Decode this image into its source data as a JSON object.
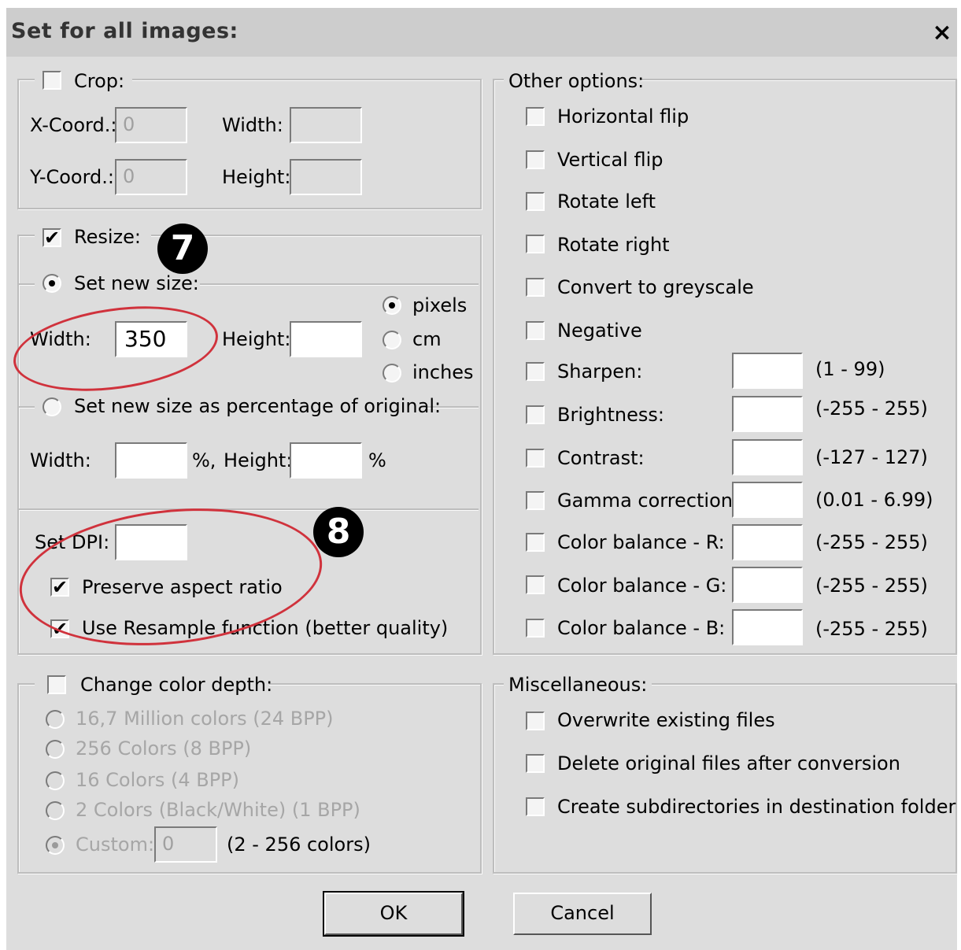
{
  "dialog": {
    "title": "Set for all images:",
    "close_glyph": "×"
  },
  "crop": {
    "label": "Crop:",
    "checked": false,
    "xcoord_label": "X-Coord.:",
    "xcoord_value": "0",
    "ycoord_label": "Y-Coord.:",
    "ycoord_value": "0",
    "width_label": "Width:",
    "height_label": "Height:"
  },
  "resize": {
    "label": "Resize:",
    "checked": true,
    "set_new_size_label": "Set new size:",
    "width_label": "Width:",
    "width_value": "350",
    "height_label": "Height:",
    "height_value": "",
    "unit_pixels": "pixels",
    "unit_cm": "cm",
    "unit_inches": "inches",
    "selected_unit": "pixels",
    "percentage_label": "Set new size as percentage of original:",
    "pct_width_label": "Width:",
    "pct_percent_sep": "%,",
    "pct_height_label": "Height:",
    "pct_percent": "%",
    "dpi_label": "Set DPI:",
    "preserve_label": "Preserve aspect ratio",
    "resample_label": "Use Resample function (better quality)"
  },
  "color_depth": {
    "label": "Change color depth:",
    "options": [
      "16,7 Million colors (24 BPP)",
      "256 Colors (8 BPP)",
      "16 Colors (4 BPP)",
      "2 Colors (Black/White) (1 BPP)"
    ],
    "custom_label": "Custom:",
    "custom_value": "0",
    "custom_range": "(2 - 256 colors)"
  },
  "other_options": {
    "label": "Other options:",
    "horizontal_flip": "Horizontal flip",
    "vertical_flip": "Vertical flip",
    "rotate_left": "Rotate left",
    "rotate_right": "Rotate right",
    "greyscale": "Convert to greyscale",
    "negative": "Negative",
    "sharpen": "Sharpen:",
    "sharpen_range": "(1  -  99)",
    "brightness": "Brightness:",
    "brightness_range": "(-255  -  255)",
    "contrast": "Contrast:",
    "contrast_range": "(-127  -  127)",
    "gamma": "Gamma correction:",
    "gamma_range": "(0.01  -  6.99)",
    "balance_r": "Color balance - R:",
    "balance_r_range": "(-255  -  255)",
    "balance_g": "Color balance - G:",
    "balance_g_range": "(-255  -  255)",
    "balance_b": "Color balance - B:",
    "balance_b_range": "(-255  -  255)"
  },
  "misc": {
    "label": "Miscellaneous:",
    "overwrite": "Overwrite existing files",
    "delete_original": "Delete original files after conversion",
    "create_subdirs": "Create subdirectories in destination folder"
  },
  "buttons": {
    "ok": "OK",
    "cancel": "Cancel"
  },
  "annotations": {
    "marker_7": "7",
    "marker_8": "8",
    "highlight_color": "#d0323c"
  },
  "check_glyph": "✔"
}
